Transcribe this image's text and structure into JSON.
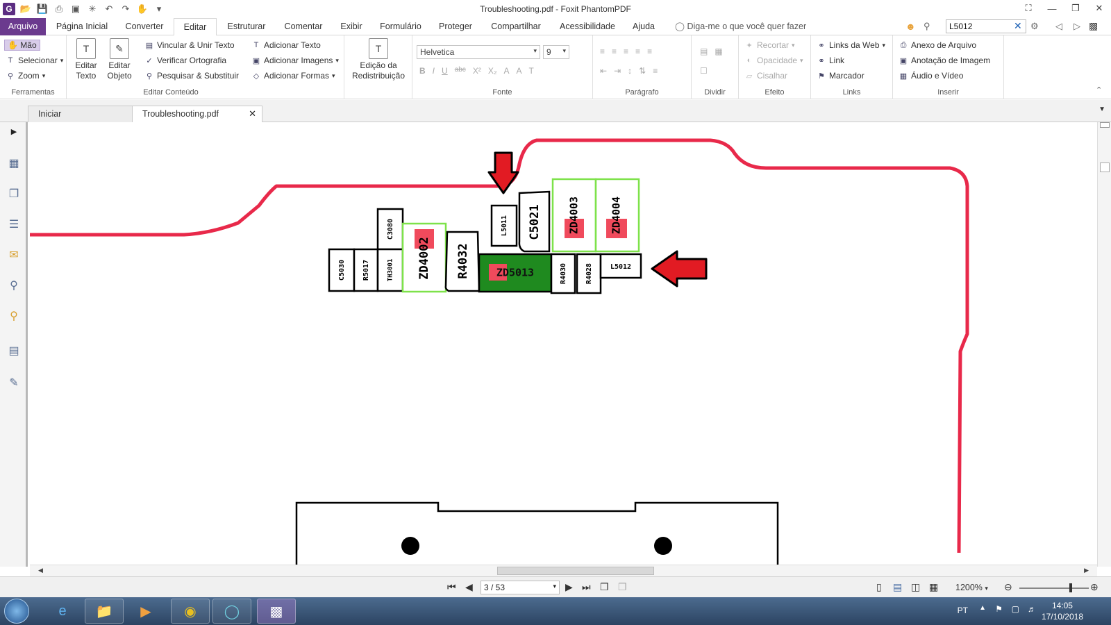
{
  "window": {
    "title": "Troubleshooting.pdf - Foxit PhantomPDF",
    "app_logo": "G"
  },
  "menu": {
    "file": "Arquivo",
    "tabs": [
      "Página Inicial",
      "Converter",
      "Editar",
      "Estruturar",
      "Comentar",
      "Exibir",
      "Formulário",
      "Proteger",
      "Compartilhar",
      "Acessibilidade",
      "Ajuda"
    ],
    "active_tab": "Editar",
    "tell_me": "Diga-me o que você quer fazer",
    "search_value": "L5012"
  },
  "ribbon": {
    "ferramentas": {
      "label": "Ferramentas",
      "hand": "Mão",
      "select": "Selecionar",
      "zoom": "Zoom"
    },
    "editar_conteudo": {
      "label": "Editar Conteúdo",
      "edit_text": "Editar Texto",
      "edit_object": "Editar Objeto",
      "link_join": "Vincular & Unir Texto",
      "spell": "Verificar Ortografia",
      "find_replace": "Pesquisar & Substituir",
      "add_text": "Adicionar Texto",
      "add_images": "Adicionar Imagens",
      "add_shapes": "Adicionar Formas",
      "redist_edit": "Edição da Redistribuição"
    },
    "fonte": {
      "label": "Fonte",
      "font_name": "Helvetica",
      "font_size": "9"
    },
    "paragrafo": {
      "label": "Parágrafo"
    },
    "dividir": {
      "label": "Dividir"
    },
    "efeito": {
      "label": "Efeito",
      "crop": "Recortar",
      "opacity": "Opacidade",
      "shear": "Cisalhar"
    },
    "links": {
      "label": "Links",
      "web_links": "Links da Web",
      "link": "Link",
      "bookmark": "Marcador"
    },
    "inserir": {
      "label": "Inserir",
      "file_attachment": "Anexo de Arquivo",
      "image_annotation": "Anotação de Imagem",
      "audio_video": "Áudio e Vídeo"
    }
  },
  "doc_tabs": {
    "start": "Iniciar",
    "doc": "Troubleshooting.pdf"
  },
  "schematic": {
    "components": {
      "c5030": "C5030",
      "r5017": "R5017",
      "c3080": "C3080",
      "th3001": "TH3001",
      "zd4002": "ZD4002",
      "r4032": "R4032",
      "l5011": "L5011",
      "c5021": "C5021",
      "zd4003": "ZD4003",
      "zd4004": "ZD4004",
      "zd5013": "ZD5013",
      "r4030": "R4030",
      "r4028": "R4028",
      "l5012": "L5012"
    },
    "colors": {
      "trace": "#e8294a",
      "highlight_green": "#1f8a1f",
      "highlight_outline": "#7ee24a",
      "marker_red": "#f04a5c",
      "arrow_red": "#e21b23"
    }
  },
  "status": {
    "page": "3 / 53",
    "zoom": "1200%"
  },
  "taskbar": {
    "lang": "PT",
    "time": "14:05",
    "date": "17/10/2018"
  }
}
